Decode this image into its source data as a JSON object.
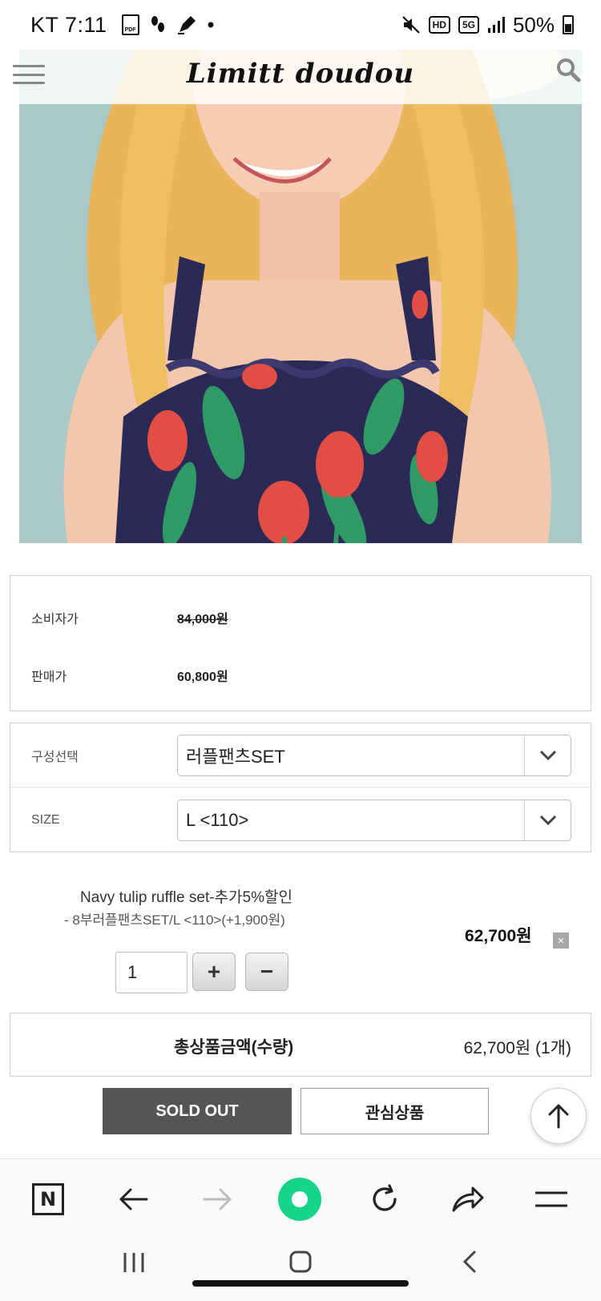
{
  "status_bar": {
    "carrier_time": "KT 7:11",
    "pdf_label": "PDF",
    "badges": [
      "HD",
      "5G"
    ],
    "battery": "50%",
    "battery_level": 0.5
  },
  "header": {
    "logo": "Limitt doudou",
    "menu_icon": "hamburger-menu-icon",
    "search_icon": "search-icon"
  },
  "price": {
    "consumer_label": "소비자가",
    "consumer_value": "84,000원",
    "sale_label": "판매가",
    "sale_value": "60,800원"
  },
  "options": {
    "composition_label": "구성선택",
    "composition_value": "러플팬츠SET",
    "size_label": "SIZE",
    "size_value": "L <110>"
  },
  "selected_item": {
    "title": "Navy tulip ruffle set-추가5%할인",
    "subtitle": "- 8부러플팬츠SET/L <110>(+1,900원)",
    "price": "62,700원",
    "remove": "×",
    "quantity": "1",
    "plus": "+",
    "minus": "−"
  },
  "total": {
    "label": "총상품금액(수량)",
    "value": "62,700원 (1개)"
  },
  "actions": {
    "sold_out": "SOLD OUT",
    "wishlist": "관심상품"
  },
  "browser_bar": {
    "naver_button": "N"
  },
  "colors": {
    "sold_out_bg": "#555555",
    "naver_green": "#16d48a",
    "hero_bg": "#a9c8c6",
    "dress_navy": "#2b2a57",
    "tulip_red": "#e24e44",
    "leaf_green": "#2f9a66"
  }
}
